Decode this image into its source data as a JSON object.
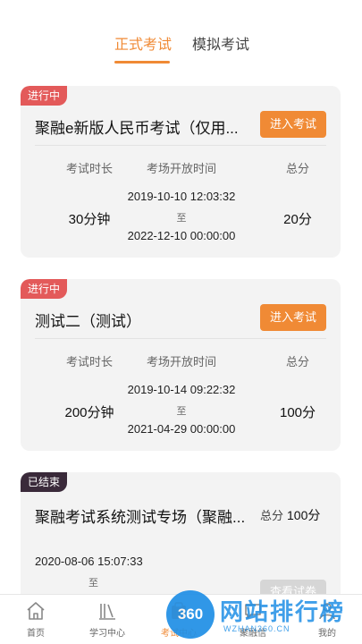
{
  "tabs": [
    {
      "label": "正式考试",
      "active": true
    },
    {
      "label": "模拟考试",
      "active": false
    }
  ],
  "cards": [
    {
      "badge": "进行中",
      "title": "聚融e新版人民币考试（仅用...",
      "button": "进入考试",
      "headers": [
        "考试时长",
        "考场开放时间",
        "总分"
      ],
      "duration": "30分钟",
      "start": "2019-10-10 12:03:32",
      "to": "至",
      "end": "2022-12-10 00:00:00",
      "score": "20分"
    },
    {
      "badge": "进行中",
      "title": "测试二（测试）",
      "button": "进入考试",
      "headers": [
        "考试时长",
        "考场开放时间",
        "总分"
      ],
      "duration": "200分钟",
      "start": "2019-10-14 09:22:32",
      "to": "至",
      "end": "2021-04-29 00:00:00",
      "score": "100分"
    },
    {
      "badge": "已结束",
      "title": "聚融考试系统测试专场（聚融...",
      "score_label": "总分",
      "score": "100分",
      "start": "2020-08-06 15:07:33",
      "to": "至",
      "button": "查看试卷"
    }
  ],
  "bottom_nav": [
    {
      "label": "首页",
      "icon": "home-icon",
      "active": false
    },
    {
      "label": "学习中心",
      "icon": "books-icon",
      "active": false
    },
    {
      "label": "考试中心",
      "icon": "exam-icon",
      "active": true
    },
    {
      "label": "聚融信",
      "icon": "chat-icon",
      "active": false
    },
    {
      "label": "我的",
      "icon": "user-icon",
      "active": false
    }
  ],
  "watermark": {
    "badge": "360",
    "text": "网站排行榜",
    "sub": "WZHAN360.CN"
  },
  "colors": {
    "accent": "#f08a35",
    "ongoing": "#e35a5a",
    "ended": "#3a2a3a",
    "card_bg": "#f3f3f3"
  }
}
